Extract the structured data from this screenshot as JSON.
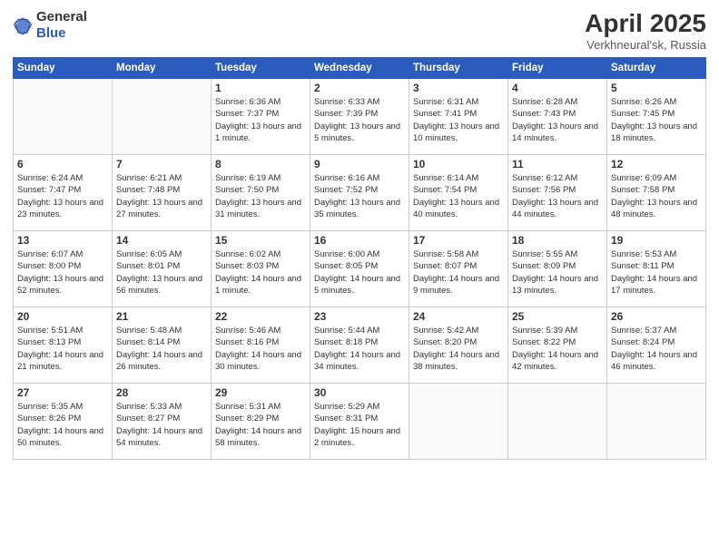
{
  "logo": {
    "general": "General",
    "blue": "Blue"
  },
  "header": {
    "month_year": "April 2025",
    "location": "Verkhneural'sk, Russia"
  },
  "days_of_week": [
    "Sunday",
    "Monday",
    "Tuesday",
    "Wednesday",
    "Thursday",
    "Friday",
    "Saturday"
  ],
  "weeks": [
    [
      {
        "day": "",
        "info": ""
      },
      {
        "day": "",
        "info": ""
      },
      {
        "day": "1",
        "info": "Sunrise: 6:36 AM\nSunset: 7:37 PM\nDaylight: 13 hours and 1 minute."
      },
      {
        "day": "2",
        "info": "Sunrise: 6:33 AM\nSunset: 7:39 PM\nDaylight: 13 hours and 5 minutes."
      },
      {
        "day": "3",
        "info": "Sunrise: 6:31 AM\nSunset: 7:41 PM\nDaylight: 13 hours and 10 minutes."
      },
      {
        "day": "4",
        "info": "Sunrise: 6:28 AM\nSunset: 7:43 PM\nDaylight: 13 hours and 14 minutes."
      },
      {
        "day": "5",
        "info": "Sunrise: 6:26 AM\nSunset: 7:45 PM\nDaylight: 13 hours and 18 minutes."
      }
    ],
    [
      {
        "day": "6",
        "info": "Sunrise: 6:24 AM\nSunset: 7:47 PM\nDaylight: 13 hours and 23 minutes."
      },
      {
        "day": "7",
        "info": "Sunrise: 6:21 AM\nSunset: 7:48 PM\nDaylight: 13 hours and 27 minutes."
      },
      {
        "day": "8",
        "info": "Sunrise: 6:19 AM\nSunset: 7:50 PM\nDaylight: 13 hours and 31 minutes."
      },
      {
        "day": "9",
        "info": "Sunrise: 6:16 AM\nSunset: 7:52 PM\nDaylight: 13 hours and 35 minutes."
      },
      {
        "day": "10",
        "info": "Sunrise: 6:14 AM\nSunset: 7:54 PM\nDaylight: 13 hours and 40 minutes."
      },
      {
        "day": "11",
        "info": "Sunrise: 6:12 AM\nSunset: 7:56 PM\nDaylight: 13 hours and 44 minutes."
      },
      {
        "day": "12",
        "info": "Sunrise: 6:09 AM\nSunset: 7:58 PM\nDaylight: 13 hours and 48 minutes."
      }
    ],
    [
      {
        "day": "13",
        "info": "Sunrise: 6:07 AM\nSunset: 8:00 PM\nDaylight: 13 hours and 52 minutes."
      },
      {
        "day": "14",
        "info": "Sunrise: 6:05 AM\nSunset: 8:01 PM\nDaylight: 13 hours and 56 minutes."
      },
      {
        "day": "15",
        "info": "Sunrise: 6:02 AM\nSunset: 8:03 PM\nDaylight: 14 hours and 1 minute."
      },
      {
        "day": "16",
        "info": "Sunrise: 6:00 AM\nSunset: 8:05 PM\nDaylight: 14 hours and 5 minutes."
      },
      {
        "day": "17",
        "info": "Sunrise: 5:58 AM\nSunset: 8:07 PM\nDaylight: 14 hours and 9 minutes."
      },
      {
        "day": "18",
        "info": "Sunrise: 5:55 AM\nSunset: 8:09 PM\nDaylight: 14 hours and 13 minutes."
      },
      {
        "day": "19",
        "info": "Sunrise: 5:53 AM\nSunset: 8:11 PM\nDaylight: 14 hours and 17 minutes."
      }
    ],
    [
      {
        "day": "20",
        "info": "Sunrise: 5:51 AM\nSunset: 8:13 PM\nDaylight: 14 hours and 21 minutes."
      },
      {
        "day": "21",
        "info": "Sunrise: 5:48 AM\nSunset: 8:14 PM\nDaylight: 14 hours and 26 minutes."
      },
      {
        "day": "22",
        "info": "Sunrise: 5:46 AM\nSunset: 8:16 PM\nDaylight: 14 hours and 30 minutes."
      },
      {
        "day": "23",
        "info": "Sunrise: 5:44 AM\nSunset: 8:18 PM\nDaylight: 14 hours and 34 minutes."
      },
      {
        "day": "24",
        "info": "Sunrise: 5:42 AM\nSunset: 8:20 PM\nDaylight: 14 hours and 38 minutes."
      },
      {
        "day": "25",
        "info": "Sunrise: 5:39 AM\nSunset: 8:22 PM\nDaylight: 14 hours and 42 minutes."
      },
      {
        "day": "26",
        "info": "Sunrise: 5:37 AM\nSunset: 8:24 PM\nDaylight: 14 hours and 46 minutes."
      }
    ],
    [
      {
        "day": "27",
        "info": "Sunrise: 5:35 AM\nSunset: 8:26 PM\nDaylight: 14 hours and 50 minutes."
      },
      {
        "day": "28",
        "info": "Sunrise: 5:33 AM\nSunset: 8:27 PM\nDaylight: 14 hours and 54 minutes."
      },
      {
        "day": "29",
        "info": "Sunrise: 5:31 AM\nSunset: 8:29 PM\nDaylight: 14 hours and 58 minutes."
      },
      {
        "day": "30",
        "info": "Sunrise: 5:29 AM\nSunset: 8:31 PM\nDaylight: 15 hours and 2 minutes."
      },
      {
        "day": "",
        "info": ""
      },
      {
        "day": "",
        "info": ""
      },
      {
        "day": "",
        "info": ""
      }
    ]
  ]
}
